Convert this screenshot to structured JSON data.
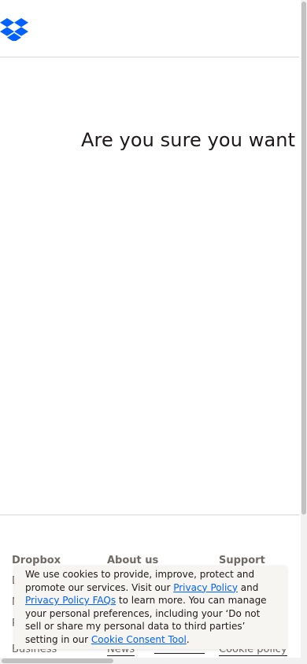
{
  "header": {
    "logo_icon": "dropbox-logo-icon",
    "brand_color": "#0061fe"
  },
  "main": {
    "heading": "Are you sure you want to"
  },
  "footer": {
    "columns": [
      {
        "title": "Dropbox",
        "items": [
          "D",
          "M",
          "P"
        ]
      },
      {
        "title": "About us",
        "items": [
          "",
          "",
          ""
        ]
      },
      {
        "title": "Support",
        "items": [
          "",
          "",
          ""
        ]
      }
    ],
    "bottom_row": {
      "business": "Business",
      "news": "News",
      "cookie_policy": "Cookie policy"
    }
  },
  "cookie_banner": {
    "text_1": "We use cookies to provide, improve, protect and promote our services. Visit our ",
    "privacy_policy_link": "Privacy Policy",
    "text_2": " and ",
    "privacy_faqs_link": "Privacy Policy FAQs",
    "text_3": " to learn more. You can manage your personal preferences, including your ‘Do not sell or share my personal data to third parties’ setting in our ",
    "consent_tool_link": "Cookie Consent Tool",
    "text_4": "."
  }
}
